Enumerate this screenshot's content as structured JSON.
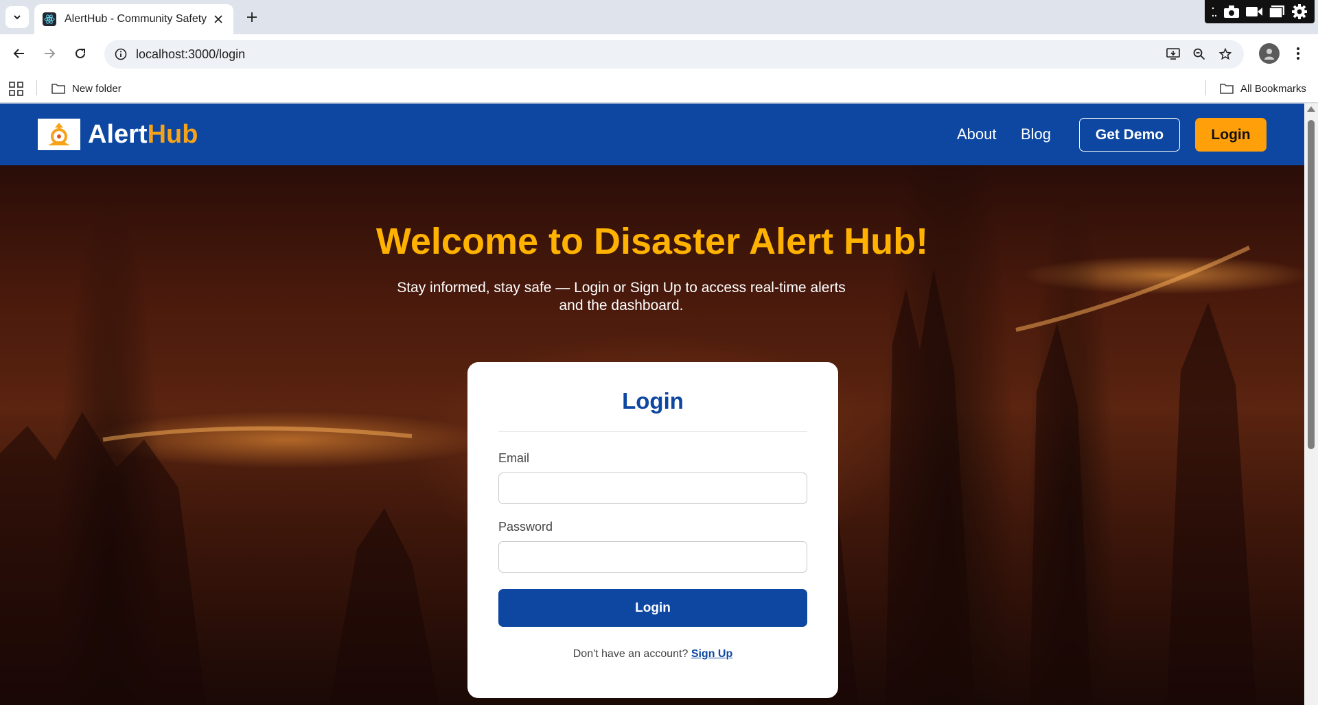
{
  "browser": {
    "tab_title": "AlertHub - Community Safety",
    "url": "localhost:3000/login",
    "bookmarks": [
      {
        "label": "New folder",
        "icon": "folder-icon"
      },
      {
        "label": "All Bookmarks",
        "icon": "folder-icon"
      }
    ]
  },
  "header": {
    "logo_first": "Alert",
    "logo_second": "Hub",
    "nav": [
      "About",
      "Blog"
    ],
    "demo_button": "Get Demo",
    "login_button": "Login"
  },
  "hero": {
    "title": "Welcome to Disaster Alert Hub!",
    "subtitle": "Stay informed, stay safe — Login or Sign Up to access real-time alerts and the dashboard."
  },
  "login_card": {
    "title": "Login",
    "email_label": "Email",
    "email_value": "",
    "password_label": "Password",
    "password_value": "",
    "submit_label": "Login",
    "signup_prompt": "Don't have an account?",
    "signup_link": "Sign Up"
  },
  "colors": {
    "brand_blue": "#0d47a1",
    "accent_orange": "#ff9f0a",
    "title_yellow": "#ffb300"
  }
}
